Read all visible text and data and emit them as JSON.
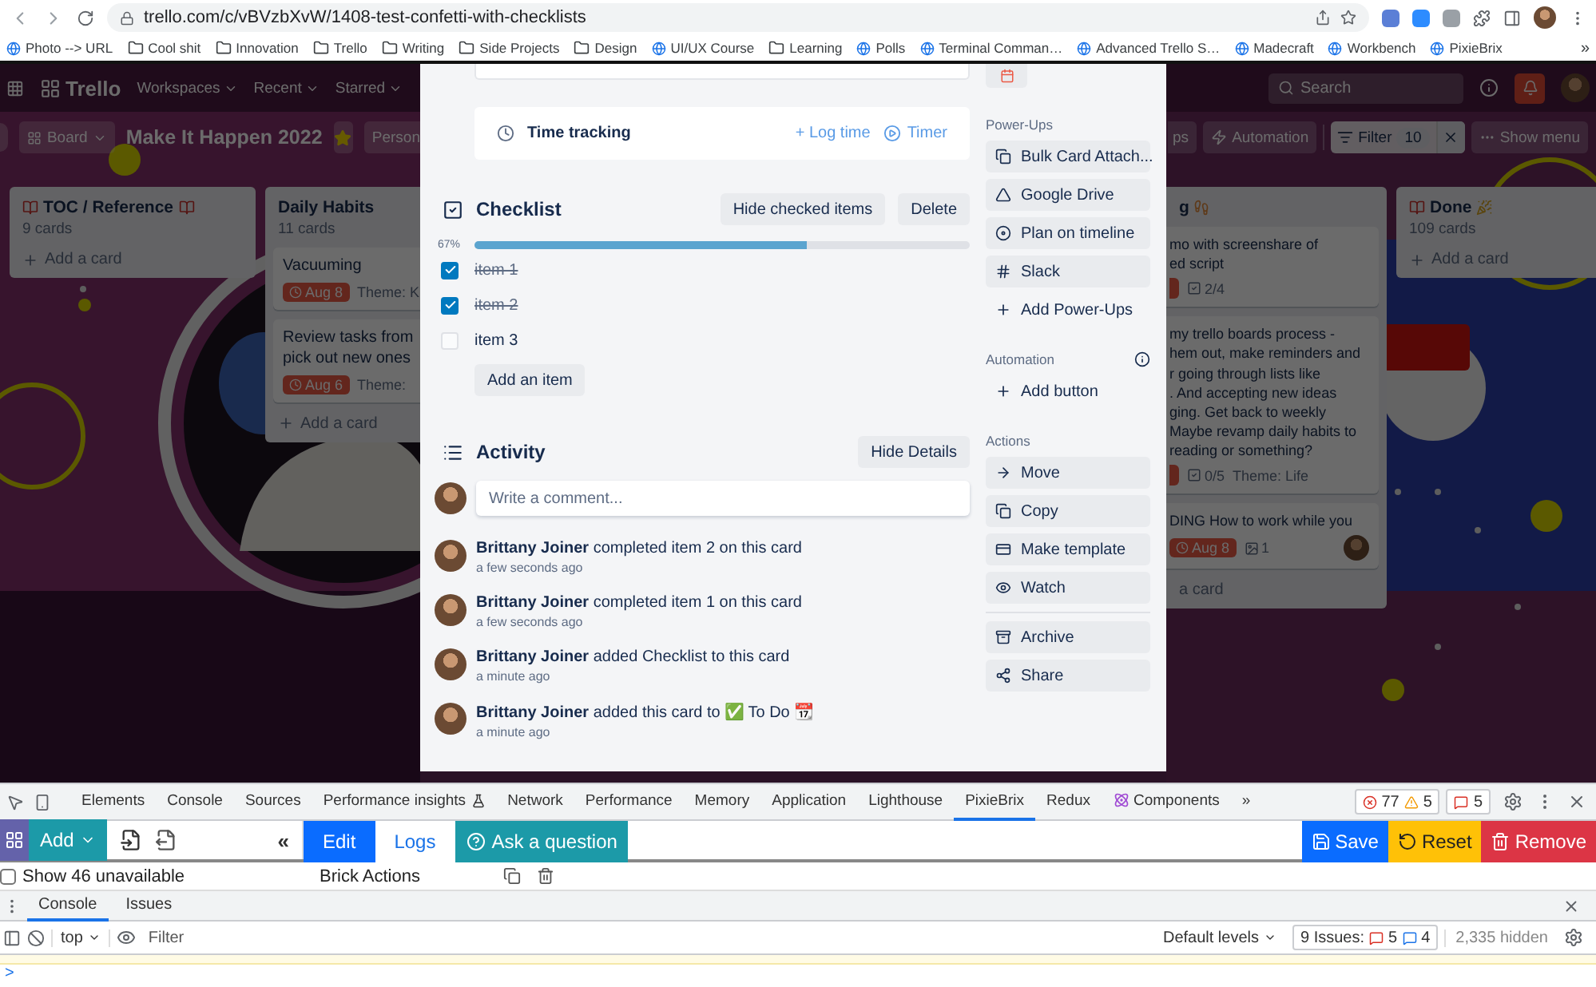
{
  "browser": {
    "url": "trello.com/c/vBVzbXvW/1408-test-confetti-with-checklists",
    "bookmarks": [
      {
        "label": "Photo --> URL",
        "kind": "page"
      },
      {
        "label": "Cool shit",
        "kind": "folder"
      },
      {
        "label": "Innovation",
        "kind": "folder"
      },
      {
        "label": "Trello",
        "kind": "folder"
      },
      {
        "label": "Writing",
        "kind": "folder"
      },
      {
        "label": "Side Projects",
        "kind": "folder"
      },
      {
        "label": "Design",
        "kind": "folder"
      },
      {
        "label": "UI/UX Course",
        "kind": "page"
      },
      {
        "label": "Learning",
        "kind": "folder"
      },
      {
        "label": "Polls",
        "kind": "page"
      },
      {
        "label": "Terminal Comman…",
        "kind": "page"
      },
      {
        "label": "Advanced Trello S…",
        "kind": "page"
      },
      {
        "label": "Madecraft",
        "kind": "page"
      },
      {
        "label": "Workbench",
        "kind": "page"
      },
      {
        "label": "PixieBrix",
        "kind": "page"
      }
    ],
    "overflow": "»"
  },
  "board": {
    "logo": "Trello",
    "menus": [
      "Workspaces",
      "Recent",
      "Starred"
    ],
    "search": {
      "placeholder": "Search"
    },
    "view": "Board",
    "title": "Make It Happen 2022",
    "starred": true,
    "cut_left": "Person",
    "cut_right": "ps",
    "automation": "Automation",
    "filter": {
      "label": "Filter",
      "count": "10"
    },
    "show_menu": "Show menu",
    "lists_left": [
      {
        "title": "TOC / Reference",
        "kind": "reference",
        "count": "9 cards",
        "add": "Add a card"
      },
      {
        "title": "Daily Habits",
        "kind": "plain",
        "count": "11 cards",
        "add": "Add a card",
        "cards": [
          {
            "title": "Vacuuming",
            "member": false,
            "badges": [
              {
                "kind": "due",
                "text": "Aug 8"
              },
              {
                "kind": "label",
                "text": "Theme: K"
              }
            ]
          },
          {
            "title": "Review tasks from\npick out new ones",
            "member": false,
            "badges": [
              {
                "kind": "due",
                "text": "Aug 6"
              },
              {
                "kind": "label",
                "text": "Theme:"
              }
            ]
          }
        ]
      }
    ],
    "lists_right": [
      {
        "title": "g",
        "kind": "progress",
        "add": "a card",
        "cards": [
          {
            "title": "mo with screenshare of\ned script",
            "member": false,
            "badges": [
              {
                "kind": "due_cut"
              },
              {
                "kind": "checklist",
                "text": "2/4"
              }
            ]
          },
          {
            "title": "my trello boards process -\nhem out, make reminders and\nr going through lists like\n. And accepting new ideas\nging. Get back to weekly\nMaybe revamp daily habits to\nreading or something?",
            "member": false,
            "badges": [
              {
                "kind": "due_cut"
              },
              {
                "kind": "checklist",
                "text": "0/5"
              },
              {
                "kind": "label",
                "text": "Theme: Life"
              }
            ]
          },
          {
            "title": "DING How to work while you",
            "member": true,
            "badges": [
              {
                "kind": "due",
                "text": "Aug 8"
              },
              {
                "kind": "attachment",
                "text": "1"
              }
            ]
          }
        ]
      },
      {
        "title": "Done",
        "kind": "done",
        "count": "109 cards",
        "add": "Add a card"
      }
    ]
  },
  "card": {
    "time_tracking": {
      "label": "Time tracking",
      "log": "+ Log time",
      "timer": "Timer"
    },
    "checklist": {
      "title": "Checklist",
      "buttons": [
        "Hide checked items",
        "Delete"
      ],
      "percent": "67%",
      "level": 0.67,
      "items": [
        {
          "text": "item 1",
          "checked": true
        },
        {
          "text": "item 2",
          "checked": true
        },
        {
          "text": "item 3",
          "checked": false
        }
      ],
      "add": "Add an item"
    },
    "activity": {
      "title": "Activity",
      "button": "Hide Details",
      "comment": {
        "placeholder": "Write a comment..."
      },
      "entries": [
        {
          "text": "**Brittany Joiner** completed item 2 on this card",
          "time": "a few seconds ago"
        },
        {
          "text": "**Brittany Joiner** completed item 1 on this card",
          "time": "a few seconds ago"
        },
        {
          "text": "**Brittany Joiner** added Checklist to this card",
          "time": "a minute ago"
        },
        {
          "text": "**Brittany Joiner** added this card to ✅ To Do 📆",
          "time": "a minute ago"
        }
      ]
    },
    "sidebar": [
      {
        "heading": "Power-Ups",
        "info": false,
        "items": [
          {
            "label": "Bulk Card Attach...",
            "kind": "attach"
          },
          {
            "label": "Google Drive",
            "kind": "drive"
          },
          {
            "label": "Plan on timeline",
            "kind": "timeline"
          },
          {
            "label": "Slack",
            "kind": "slack"
          },
          {
            "label": "Add Power-Ups",
            "kind": "add"
          }
        ]
      },
      {
        "heading": "Automation",
        "info": true,
        "items": [
          {
            "label": "Add button",
            "kind": "add"
          }
        ]
      },
      {
        "heading": "Actions",
        "info": false,
        "items": [
          {
            "label": "Move",
            "kind": "move"
          },
          {
            "label": "Copy",
            "kind": "copy"
          },
          {
            "label": "Make template",
            "kind": "template"
          },
          {
            "label": "Watch",
            "kind": "watch"
          },
          {
            "kind": "divider"
          },
          {
            "label": "Archive",
            "kind": "archive"
          },
          {
            "label": "Share",
            "kind": "share"
          }
        ]
      }
    ]
  },
  "devtools": {
    "tabs": [
      {
        "label": "Elements",
        "kind": "plain",
        "selected": false
      },
      {
        "label": "Console",
        "kind": "plain",
        "selected": false
      },
      {
        "label": "Sources",
        "kind": "plain",
        "selected": false
      },
      {
        "label": "Performance insights",
        "kind": "experiment",
        "selected": false
      },
      {
        "label": "Network",
        "kind": "plain",
        "selected": false
      },
      {
        "label": "Performance",
        "kind": "plain",
        "selected": false
      },
      {
        "label": "Memory",
        "kind": "plain",
        "selected": false
      },
      {
        "label": "Application",
        "kind": "plain",
        "selected": false
      },
      {
        "label": "Lighthouse",
        "kind": "plain",
        "selected": false
      },
      {
        "label": "PixieBrix",
        "kind": "plain",
        "selected": true
      },
      {
        "label": "Redux",
        "kind": "plain",
        "selected": false
      },
      {
        "label": "Components",
        "kind": "react",
        "selected": false
      }
    ],
    "more": "»",
    "errors": "77",
    "warnings": "5",
    "issues": "5",
    "pixiebrix": {
      "add": "Add",
      "collapse": "«",
      "modes": [
        {
          "label": "Edit",
          "selected": true
        },
        {
          "label": "Logs",
          "selected": false
        }
      ],
      "ask": "Ask a question",
      "actions": [
        {
          "label": "Save",
          "kind": "save"
        },
        {
          "label": "Reset",
          "kind": "reset"
        },
        {
          "label": "Remove",
          "kind": "remove"
        }
      ],
      "show_unavailable": {
        "label": "Show 46 unavailable",
        "checked": false
      },
      "brick_actions": "Brick Actions"
    },
    "drawer": {
      "tabs": [
        {
          "label": "Console",
          "selected": true
        },
        {
          "label": "Issues",
          "selected": false
        }
      ],
      "context": "top",
      "filter": {
        "placeholder": "Filter"
      },
      "levels": "Default levels",
      "issues": {
        "label": "9 Issues:",
        "errors": "5",
        "info": "4"
      },
      "hidden": "2,335 hidden",
      "prompt": ">"
    }
  }
}
